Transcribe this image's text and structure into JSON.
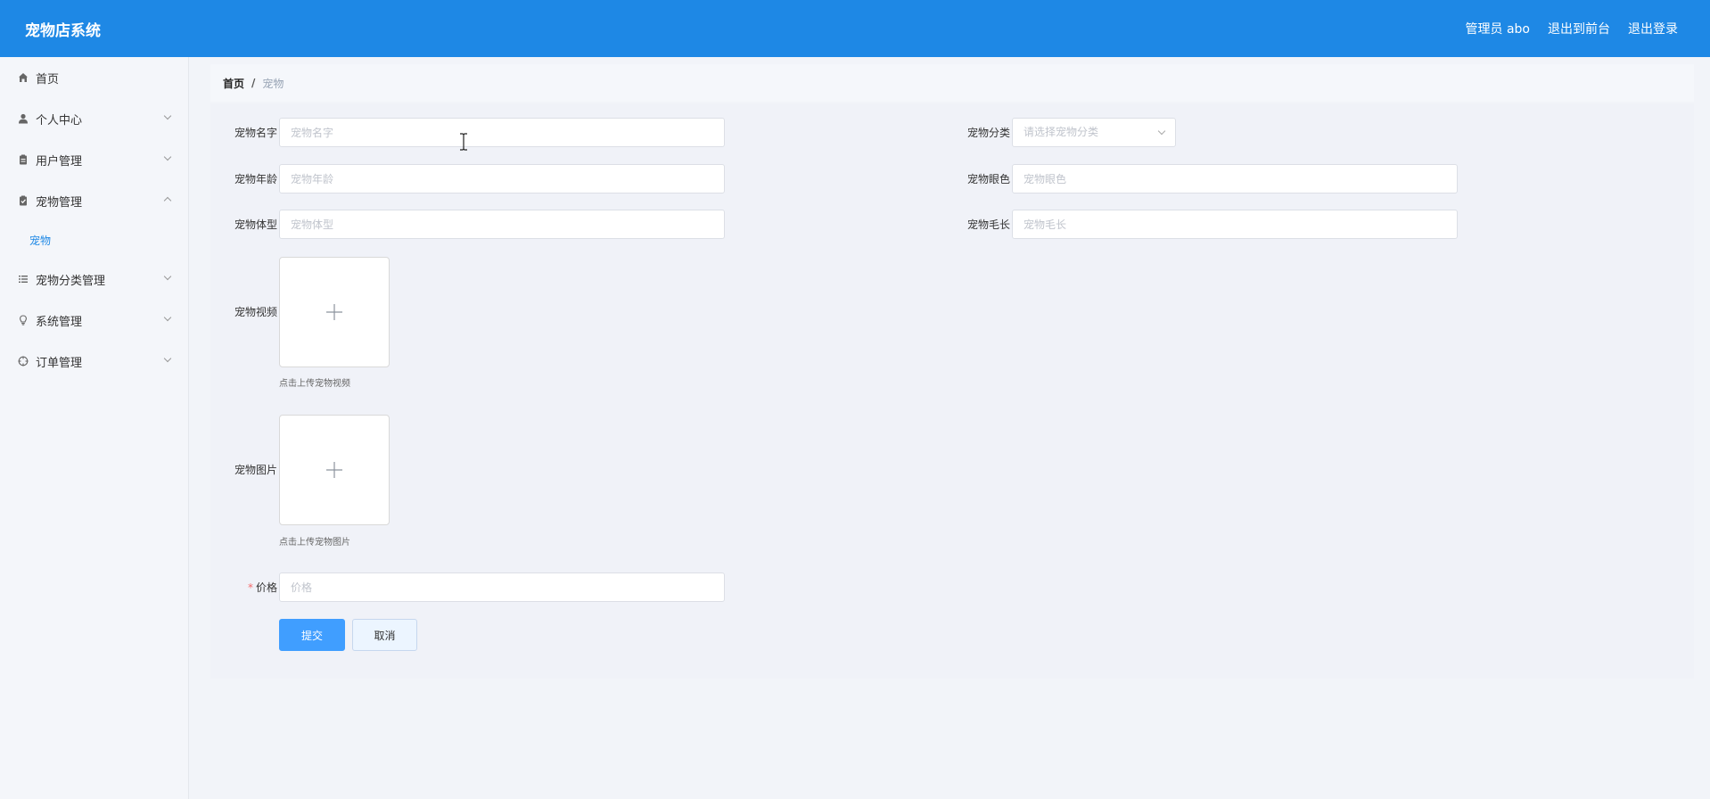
{
  "header": {
    "title": "宠物店系统",
    "links": {
      "admin": "管理员 abo",
      "frontend": "退出到前台",
      "logout": "退出登录"
    }
  },
  "sidebar": {
    "items": [
      {
        "label": "首页",
        "icon": "home-icon"
      },
      {
        "label": "个人中心",
        "icon": "user-icon"
      },
      {
        "label": "用户管理",
        "icon": "clipboard-icon"
      },
      {
        "label": "宠物管理",
        "icon": "clipboard-check-icon",
        "expanded": true
      },
      {
        "label": "宠物分类管理",
        "icon": "list-icon"
      },
      {
        "label": "系统管理",
        "icon": "lightbulb-icon"
      },
      {
        "label": "订单管理",
        "icon": "crosshair-icon"
      }
    ],
    "active_sub": "宠物"
  },
  "breadcrumb": {
    "home": "首页",
    "separator": "/",
    "current": "宠物"
  },
  "form": {
    "name": {
      "label": "宠物名字",
      "placeholder": "宠物名字",
      "value": ""
    },
    "category": {
      "label": "宠物分类",
      "placeholder": "请选择宠物分类"
    },
    "age": {
      "label": "宠物年龄",
      "placeholder": "宠物年龄",
      "value": ""
    },
    "eye_color": {
      "label": "宠物眼色",
      "placeholder": "宠物眼色",
      "value": ""
    },
    "body_type": {
      "label": "宠物体型",
      "placeholder": "宠物体型",
      "value": ""
    },
    "fur_length": {
      "label": "宠物毛长",
      "placeholder": "宠物毛长",
      "value": ""
    },
    "video": {
      "label": "宠物视频",
      "tip": "点击上传宠物视频"
    },
    "image": {
      "label": "宠物图片",
      "tip": "点击上传宠物图片"
    },
    "price": {
      "label": "价格",
      "required_mark": "*",
      "placeholder": "价格",
      "value": ""
    },
    "submit_label": "提交",
    "cancel_label": "取消"
  },
  "colors": {
    "header_bg": "#1e88e5",
    "primary_button": "#409eff",
    "active_menu_text": "#1e88e5",
    "required_mark": "#f56c6c"
  }
}
